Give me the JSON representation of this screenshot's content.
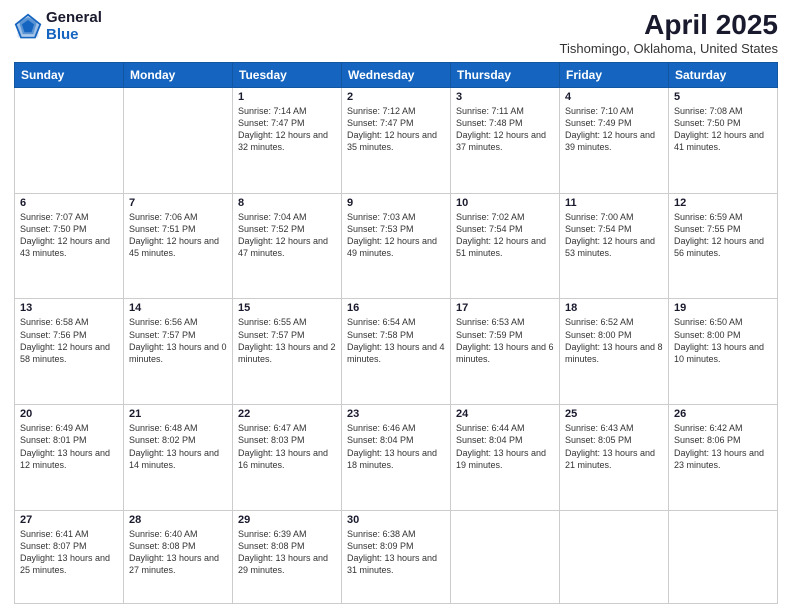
{
  "header": {
    "logo_general": "General",
    "logo_blue": "Blue",
    "month_title": "April 2025",
    "location": "Tishomingo, Oklahoma, United States"
  },
  "weekdays": [
    "Sunday",
    "Monday",
    "Tuesday",
    "Wednesday",
    "Thursday",
    "Friday",
    "Saturday"
  ],
  "weeks": [
    [
      {
        "day": "",
        "info": ""
      },
      {
        "day": "",
        "info": ""
      },
      {
        "day": "1",
        "info": "Sunrise: 7:14 AM\nSunset: 7:47 PM\nDaylight: 12 hours\nand 32 minutes."
      },
      {
        "day": "2",
        "info": "Sunrise: 7:12 AM\nSunset: 7:47 PM\nDaylight: 12 hours\nand 35 minutes."
      },
      {
        "day": "3",
        "info": "Sunrise: 7:11 AM\nSunset: 7:48 PM\nDaylight: 12 hours\nand 37 minutes."
      },
      {
        "day": "4",
        "info": "Sunrise: 7:10 AM\nSunset: 7:49 PM\nDaylight: 12 hours\nand 39 minutes."
      },
      {
        "day": "5",
        "info": "Sunrise: 7:08 AM\nSunset: 7:50 PM\nDaylight: 12 hours\nand 41 minutes."
      }
    ],
    [
      {
        "day": "6",
        "info": "Sunrise: 7:07 AM\nSunset: 7:50 PM\nDaylight: 12 hours\nand 43 minutes."
      },
      {
        "day": "7",
        "info": "Sunrise: 7:06 AM\nSunset: 7:51 PM\nDaylight: 12 hours\nand 45 minutes."
      },
      {
        "day": "8",
        "info": "Sunrise: 7:04 AM\nSunset: 7:52 PM\nDaylight: 12 hours\nand 47 minutes."
      },
      {
        "day": "9",
        "info": "Sunrise: 7:03 AM\nSunset: 7:53 PM\nDaylight: 12 hours\nand 49 minutes."
      },
      {
        "day": "10",
        "info": "Sunrise: 7:02 AM\nSunset: 7:54 PM\nDaylight: 12 hours\nand 51 minutes."
      },
      {
        "day": "11",
        "info": "Sunrise: 7:00 AM\nSunset: 7:54 PM\nDaylight: 12 hours\nand 53 minutes."
      },
      {
        "day": "12",
        "info": "Sunrise: 6:59 AM\nSunset: 7:55 PM\nDaylight: 12 hours\nand 56 minutes."
      }
    ],
    [
      {
        "day": "13",
        "info": "Sunrise: 6:58 AM\nSunset: 7:56 PM\nDaylight: 12 hours\nand 58 minutes."
      },
      {
        "day": "14",
        "info": "Sunrise: 6:56 AM\nSunset: 7:57 PM\nDaylight: 13 hours\nand 0 minutes."
      },
      {
        "day": "15",
        "info": "Sunrise: 6:55 AM\nSunset: 7:57 PM\nDaylight: 13 hours\nand 2 minutes."
      },
      {
        "day": "16",
        "info": "Sunrise: 6:54 AM\nSunset: 7:58 PM\nDaylight: 13 hours\nand 4 minutes."
      },
      {
        "day": "17",
        "info": "Sunrise: 6:53 AM\nSunset: 7:59 PM\nDaylight: 13 hours\nand 6 minutes."
      },
      {
        "day": "18",
        "info": "Sunrise: 6:52 AM\nSunset: 8:00 PM\nDaylight: 13 hours\nand 8 minutes."
      },
      {
        "day": "19",
        "info": "Sunrise: 6:50 AM\nSunset: 8:00 PM\nDaylight: 13 hours\nand 10 minutes."
      }
    ],
    [
      {
        "day": "20",
        "info": "Sunrise: 6:49 AM\nSunset: 8:01 PM\nDaylight: 13 hours\nand 12 minutes."
      },
      {
        "day": "21",
        "info": "Sunrise: 6:48 AM\nSunset: 8:02 PM\nDaylight: 13 hours\nand 14 minutes."
      },
      {
        "day": "22",
        "info": "Sunrise: 6:47 AM\nSunset: 8:03 PM\nDaylight: 13 hours\nand 16 minutes."
      },
      {
        "day": "23",
        "info": "Sunrise: 6:46 AM\nSunset: 8:04 PM\nDaylight: 13 hours\nand 18 minutes."
      },
      {
        "day": "24",
        "info": "Sunrise: 6:44 AM\nSunset: 8:04 PM\nDaylight: 13 hours\nand 19 minutes."
      },
      {
        "day": "25",
        "info": "Sunrise: 6:43 AM\nSunset: 8:05 PM\nDaylight: 13 hours\nand 21 minutes."
      },
      {
        "day": "26",
        "info": "Sunrise: 6:42 AM\nSunset: 8:06 PM\nDaylight: 13 hours\nand 23 minutes."
      }
    ],
    [
      {
        "day": "27",
        "info": "Sunrise: 6:41 AM\nSunset: 8:07 PM\nDaylight: 13 hours\nand 25 minutes."
      },
      {
        "day": "28",
        "info": "Sunrise: 6:40 AM\nSunset: 8:08 PM\nDaylight: 13 hours\nand 27 minutes."
      },
      {
        "day": "29",
        "info": "Sunrise: 6:39 AM\nSunset: 8:08 PM\nDaylight: 13 hours\nand 29 minutes."
      },
      {
        "day": "30",
        "info": "Sunrise: 6:38 AM\nSunset: 8:09 PM\nDaylight: 13 hours\nand 31 minutes."
      },
      {
        "day": "",
        "info": ""
      },
      {
        "day": "",
        "info": ""
      },
      {
        "day": "",
        "info": ""
      }
    ]
  ]
}
